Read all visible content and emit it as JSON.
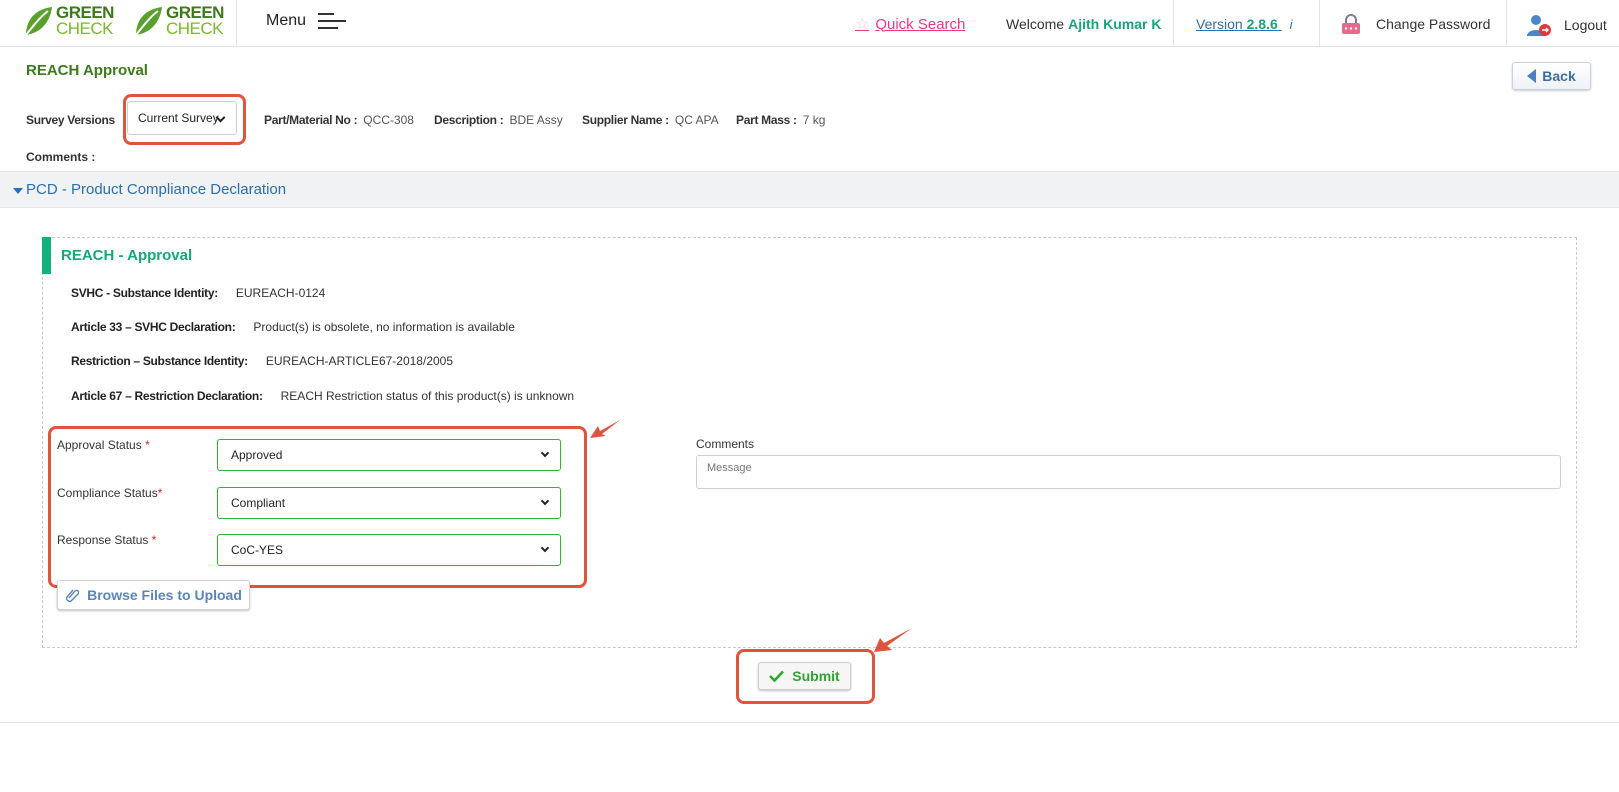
{
  "header": {
    "logo_word1": "GREEN",
    "logo_word2": "CHECK",
    "menu_label": "Menu",
    "quick_search": "Quick Search",
    "welcome_prefix": "Welcome",
    "user_name": "Ajith Kumar K",
    "version_prefix": "Version",
    "version_number": "2.8.6",
    "info_glyph": "i",
    "change_password": "Change Password",
    "logout": "Logout"
  },
  "page": {
    "title": "REACH Approval",
    "back_label": "Back",
    "survey_versions_label": "Survey Versions",
    "survey_version_selected": "Current Survey",
    "part_no_label": "Part/Material No :",
    "part_no_value": "QCC-308",
    "description_label": "Description :",
    "description_value": "BDE Assy",
    "supplier_label": "Supplier Name :",
    "supplier_value": "QC APA",
    "part_mass_label": "Part Mass :",
    "part_mass_value": "7 kg",
    "comments_label": "Comments :"
  },
  "section": {
    "title": "PCD - Product Compliance Declaration"
  },
  "panel": {
    "title": "REACH - Approval",
    "fields": [
      {
        "label": "SVHC - Substance Identity:",
        "value": "EUREACH-0124"
      },
      {
        "label": "Article 33 – SVHC Declaration:",
        "value": "Product(s) is obsolete, no information is available"
      },
      {
        "label": "Restriction – Substance Identity:",
        "value": "EUREACH-ARTICLE67-2018/2005"
      },
      {
        "label": "Article 67 – Restriction Declaration:",
        "value": "REACH Restriction status of this product(s) is unknown"
      }
    ],
    "approval_status_label": "Approval Status",
    "approval_status_value": "Approved",
    "compliance_status_label": "Compliance Status",
    "compliance_status_value": "Compliant",
    "response_status_label": "Response Status",
    "response_status_value": "CoC-YES",
    "required_mark": "*",
    "comments_label": "Comments",
    "comments_placeholder": "Message",
    "browse_label": "Browse Files to Upload",
    "submit_label": "Submit"
  },
  "colors": {
    "brand_dark_green": "#3d7a1c",
    "brand_light_green": "#7ab82e",
    "accent_teal": "#14b07e",
    "link_blue": "#2a6fb0",
    "quick_search_pink": "#e8388a",
    "annotation_red": "#e0533e"
  }
}
